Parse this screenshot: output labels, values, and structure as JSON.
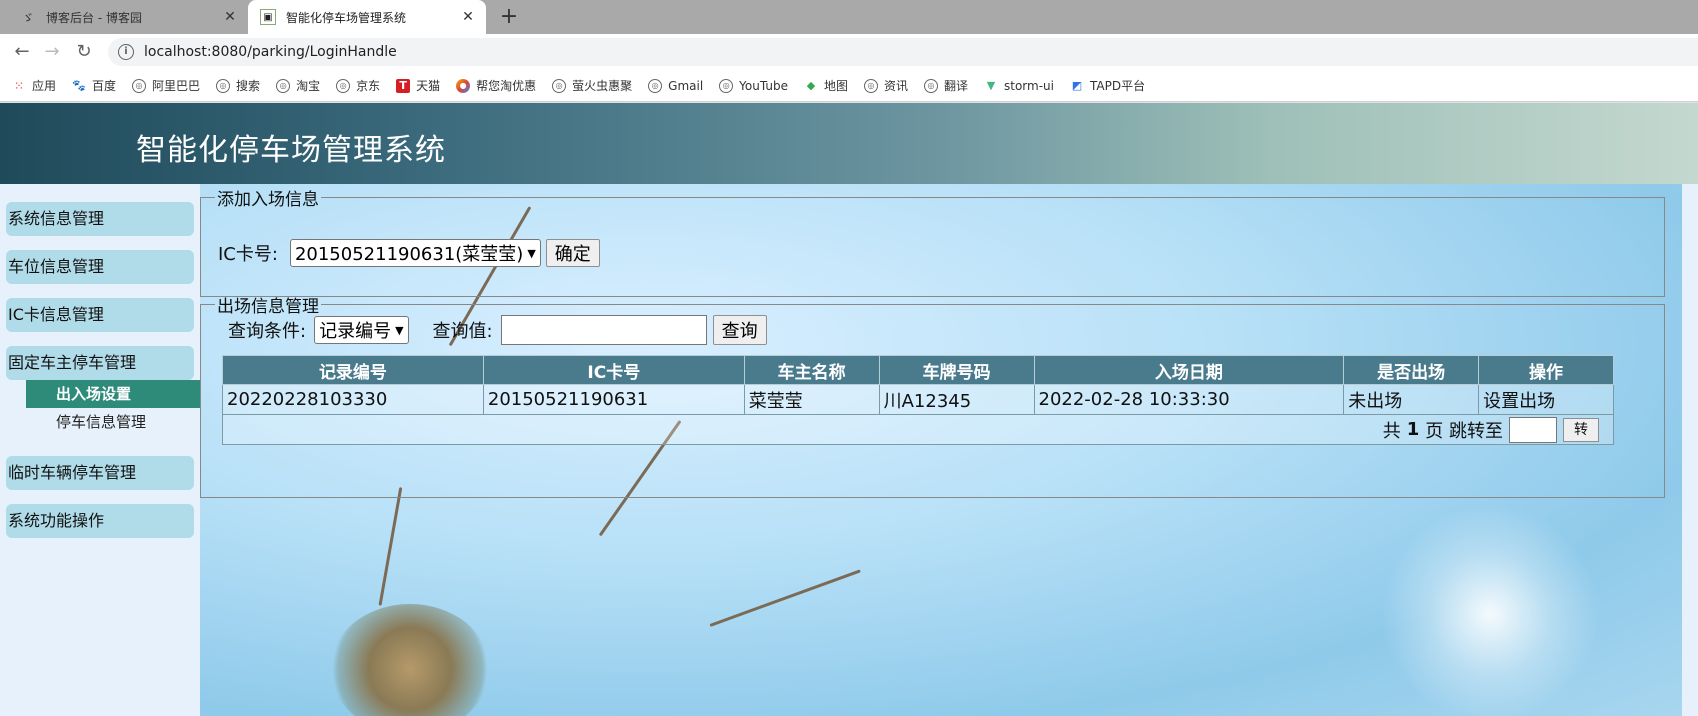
{
  "browser": {
    "tabs": [
      {
        "title": "博客后台 - 博客园",
        "active": false
      },
      {
        "title": "智能化停车场管理系统",
        "active": true
      }
    ],
    "url": "localhost:8080/parking/LoginHandle",
    "bookmarks": [
      "应用",
      "百度",
      "阿里巴巴",
      "搜索",
      "淘宝",
      "京东",
      "天猫",
      "帮您淘优惠",
      "萤火虫惠聚",
      "Gmail",
      "YouTube",
      "地图",
      "资讯",
      "翻译",
      "storm-ui",
      "TAPD平台"
    ]
  },
  "header": {
    "title": "智能化停车场管理系统"
  },
  "sidebar": {
    "groups": [
      "系统信息管理",
      "车位信息管理",
      "IC卡信息管理",
      "固定车主停车管理",
      "临时车辆停车管理",
      "系统功能操作"
    ],
    "submenu": [
      "出入场设置",
      "停车信息管理"
    ]
  },
  "entry": {
    "legend": "添加入场信息",
    "label": "IC卡号:",
    "selected": "20150521190631(菜莹莹)",
    "confirm": "确定"
  },
  "exit": {
    "legend": "出场信息管理",
    "cond_label": "查询条件:",
    "cond_selected": "记录编号",
    "value_label": "查询值:",
    "query_btn": "查询",
    "columns": [
      "记录编号",
      "IC卡号",
      "车主名称",
      "车牌号码",
      "入场日期",
      "是否出场",
      "操作"
    ],
    "rows": [
      [
        "20220228103330",
        "20150521190631",
        "菜莹莹",
        "川A12345",
        "2022-02-28 10:33:30",
        "未出场",
        "设置出场"
      ]
    ],
    "pager": {
      "prefix": "共",
      "pages": "1",
      "mid": "页 跳转至",
      "go": "转"
    }
  }
}
